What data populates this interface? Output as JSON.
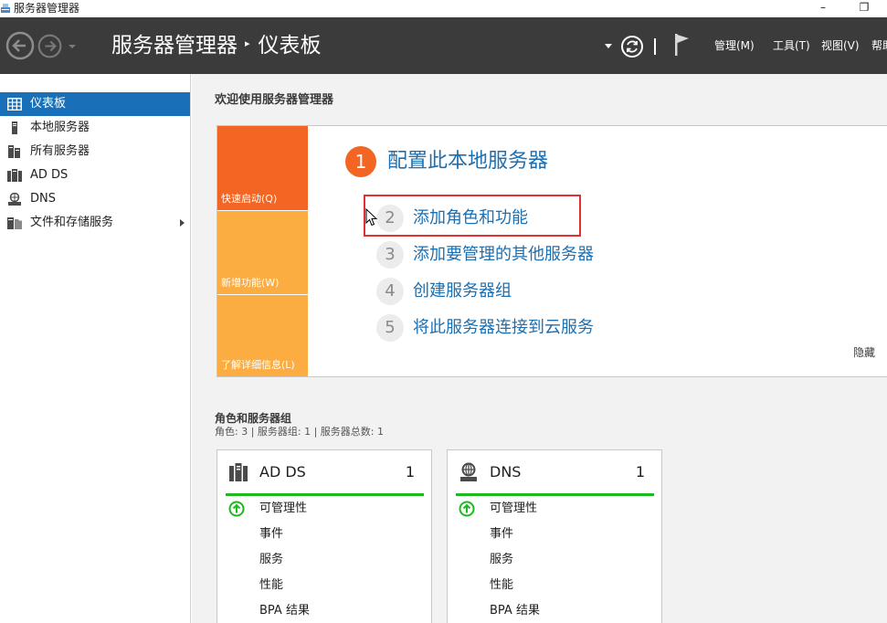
{
  "window": {
    "title": "服务器管理器",
    "minimize_glyph": "–",
    "restore_glyph": "❐"
  },
  "header": {
    "app_name": "服务器管理器",
    "separator": "▸",
    "page": "仪表板",
    "menus": [
      {
        "label": "管理(M)"
      },
      {
        "label": "工具(T)"
      },
      {
        "label": "视图(V)"
      },
      {
        "label": "帮助"
      }
    ]
  },
  "sidebar": {
    "items": [
      {
        "label": "仪表板",
        "icon": "dashboard-grid-icon",
        "active": true
      },
      {
        "label": "本地服务器",
        "icon": "server-icon"
      },
      {
        "label": "所有服务器",
        "icon": "servers-icon"
      },
      {
        "label": "AD DS",
        "icon": "ad-ds-icon"
      },
      {
        "label": "DNS",
        "icon": "dns-icon"
      },
      {
        "label": "文件和存储服务",
        "icon": "storage-icon",
        "has_children": true
      }
    ]
  },
  "main": {
    "welcome": "欢迎使用服务器管理器",
    "quick_start": {
      "tabs": [
        {
          "label": "快速启动(Q)",
          "color": "#f26522"
        },
        {
          "label": "新增功能(W)",
          "color": "#fbad41"
        },
        {
          "label": "了解详细信息(L)",
          "color": "#fbad41"
        }
      ],
      "primary": {
        "num": "1",
        "label": "配置此本地服务器"
      },
      "steps": [
        {
          "num": "2",
          "label": "添加角色和功能"
        },
        {
          "num": "3",
          "label": "添加要管理的其他服务器"
        },
        {
          "num": "4",
          "label": "创建服务器组"
        },
        {
          "num": "5",
          "label": "将此服务器连接到云服务"
        }
      ],
      "hide": "隐藏"
    },
    "roles": {
      "title": "角色和服务器组",
      "summary": "角色: 3 | 服务器组: 1 | 服务器总数: 1",
      "tiles": [
        {
          "name": "AD DS",
          "count": "1",
          "icon": "ad-ds-icon",
          "status_color": "#1dba1d",
          "rows": [
            "可管理性",
            "事件",
            "服务",
            "性能",
            "BPA 结果"
          ]
        },
        {
          "name": "DNS",
          "count": "1",
          "icon": "dns-icon",
          "status_color": "#1dba1d",
          "rows": [
            "可管理性",
            "事件",
            "服务",
            "性能",
            "BPA 结果"
          ]
        }
      ]
    }
  },
  "colors": {
    "header_bg": "#3b3b3b",
    "accent_blue": "#1a70b8",
    "link_blue": "#1d6fb0",
    "orange": "#f26522",
    "amber": "#fbad41",
    "highlight_red": "#e0302f"
  }
}
